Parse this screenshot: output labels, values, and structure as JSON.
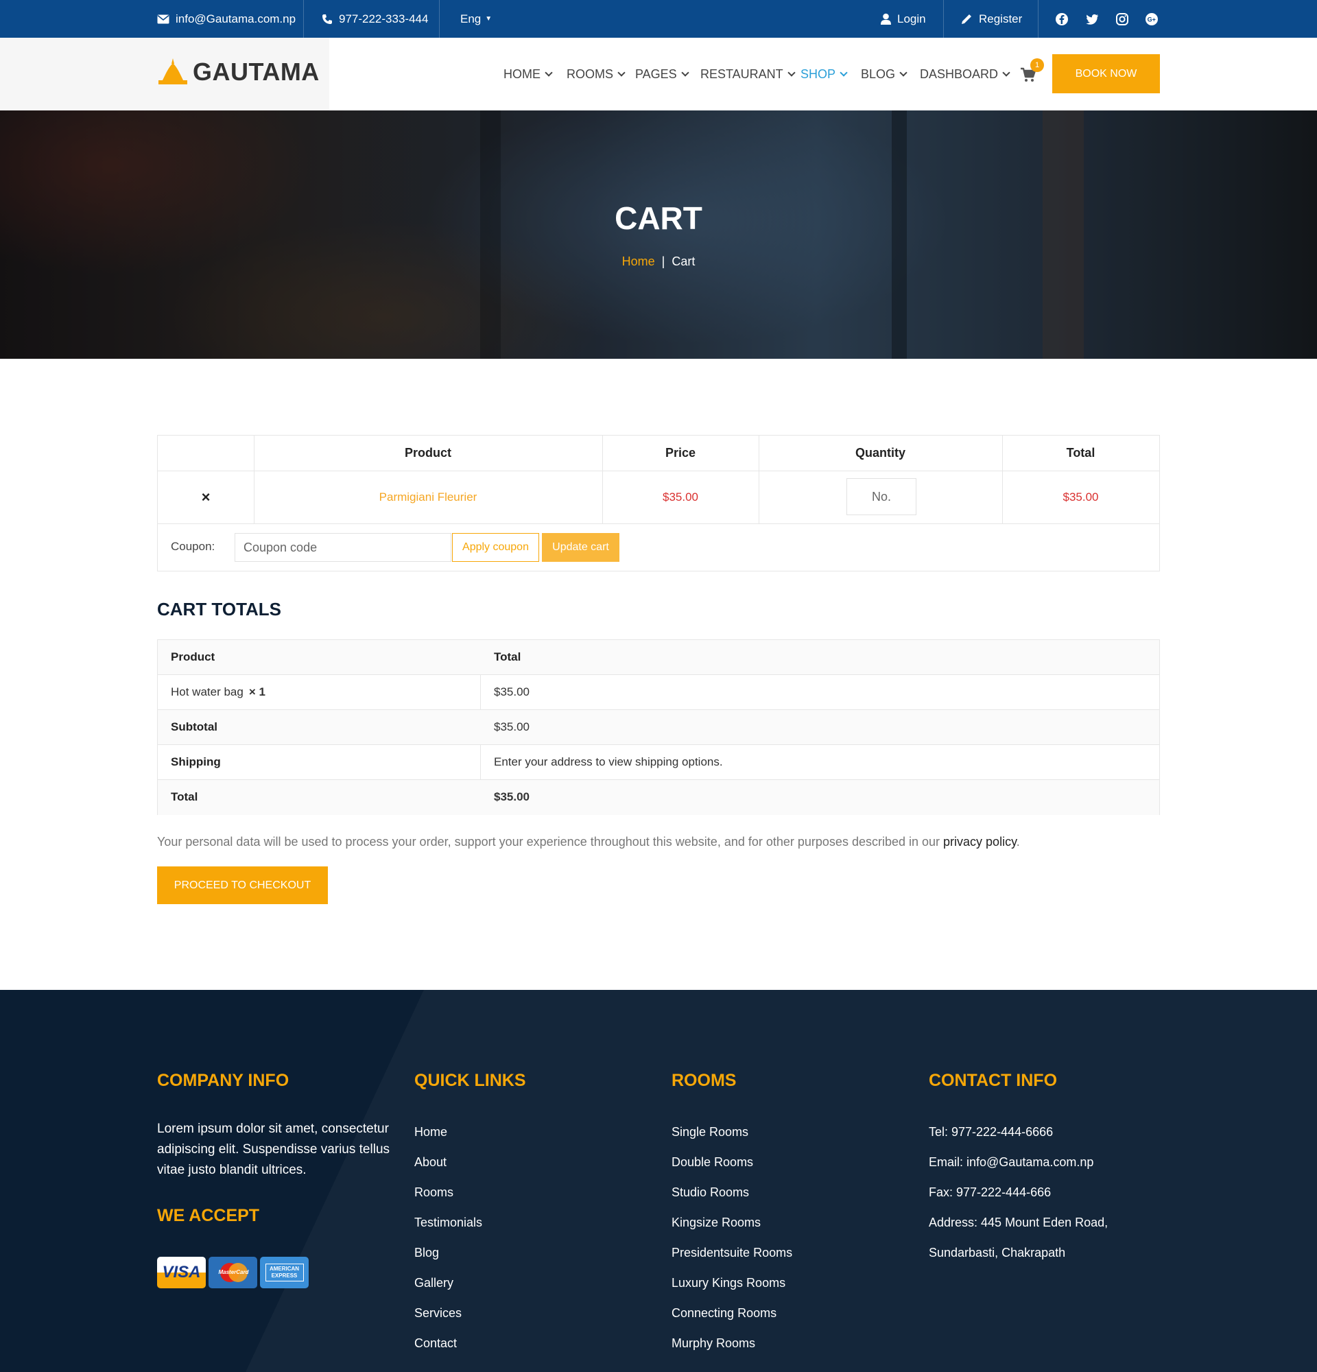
{
  "topbar": {
    "email": "info@Gautama.com.np",
    "phone": "977-222-333-444",
    "language": "Eng",
    "login": "Login",
    "register": "Register",
    "social_icons": [
      "facebook-icon",
      "twitter-icon",
      "instagram-icon",
      "google-plus-icon"
    ]
  },
  "brand": {
    "name": "GAUTAMA",
    "accent": "#f7a708",
    "topbar_color": "#0b4a8b",
    "footer_color": "#0b1e33"
  },
  "nav": {
    "items": [
      {
        "label": "HOME"
      },
      {
        "label": "ROOMS"
      },
      {
        "label": "PAGES"
      },
      {
        "label": "RESTAURANT"
      },
      {
        "label": "SHOP"
      },
      {
        "label": "BLOG"
      },
      {
        "label": "DASHBOARD"
      }
    ],
    "active": "SHOP",
    "cart_count": "1",
    "book_now": "BOOK NOW"
  },
  "hero": {
    "title": "CART",
    "breadcrumb_home": "Home",
    "breadcrumb_separator": "|",
    "breadcrumb_current": "Cart"
  },
  "cart": {
    "headers": {
      "product": "Product",
      "price": "Price",
      "quantity": "Quantity",
      "total": "Total"
    },
    "items": [
      {
        "remove": "×",
        "product": "Parmigiani Fleurier",
        "price": "$35.00",
        "quantity_placeholder": "No.",
        "total": "$35.00"
      }
    ],
    "coupon_label": "Coupon:",
    "coupon_placeholder": "Coupon code",
    "apply_coupon": "Apply coupon",
    "update_cart": "Update cart"
  },
  "totals": {
    "title": "CART TOTALS",
    "header_product": "Product",
    "header_total": "Total",
    "item_name": "Hot water bag",
    "item_qty": "× 1",
    "item_total": "$35.00",
    "subtotal_label": "Subtotal",
    "subtotal_value": "$35.00",
    "shipping_label": "Shipping",
    "shipping_value": "Enter your address to view shipping options.",
    "total_label": "Total",
    "total_value": "$35.00"
  },
  "privacy": {
    "text": "Your personal data will be used to process your order, support your experience throughout this website, and for other purposes described in our",
    "link": "privacy policy",
    "end": "."
  },
  "checkout": "PROCEED TO CHECKOUT",
  "footer": {
    "company": {
      "title": "COMPANY INFO",
      "text": "Lorem ipsum dolor sit amet, consectetur adipiscing elit. Suspendisse varius tellus vitae justo blandit ultrices.",
      "accept_title": "WE ACCEPT",
      "cards": [
        "VISA",
        "MasterCard",
        "AMERICAN EXPRESS"
      ]
    },
    "quick_links": {
      "title": "QUICK LINKS",
      "links": [
        "Home",
        "About",
        "Rooms",
        "Testimonials",
        "Blog",
        "Gallery",
        "Services",
        "Contact"
      ]
    },
    "rooms": {
      "title": "ROOMS",
      "links": [
        "Single Rooms",
        "Double Rooms",
        "Studio Rooms",
        "Kingsize Rooms",
        "Presidentsuite Rooms",
        "Luxury Kings Rooms",
        "Connecting Rooms",
        "Murphy Rooms"
      ]
    },
    "contact": {
      "title": "CONTACT INFO",
      "lines": [
        "Tel: 977-222-444-6666",
        "Email: info@Gautama.com.np",
        "Fax: 977-222-444-666",
        "Address: 445 Mount Eden Road,",
        "Sundarbasti, Chakrapath"
      ]
    }
  }
}
